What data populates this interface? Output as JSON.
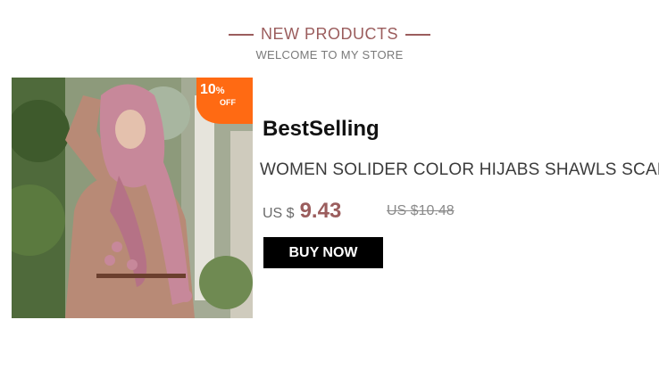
{
  "header": {
    "title": "NEW PRODUCTS",
    "subtitle": "WELCOME TO MY STORE"
  },
  "product": {
    "image_alt": "Woman wearing pink hijab scarf",
    "badge": {
      "value": "10",
      "percent_sign": "%",
      "off": "OFF",
      "color": "#ff6600"
    },
    "label": "BestSelling",
    "title": "WOMEN SOLIDER COLOR HIJABS SHAWLS SCARF",
    "currency": "US $",
    "price": "9.43",
    "old_price": "US $10.48",
    "buy_label": "BUY NOW"
  },
  "colors": {
    "accent": "#9b5d5d",
    "button": "#000000"
  }
}
